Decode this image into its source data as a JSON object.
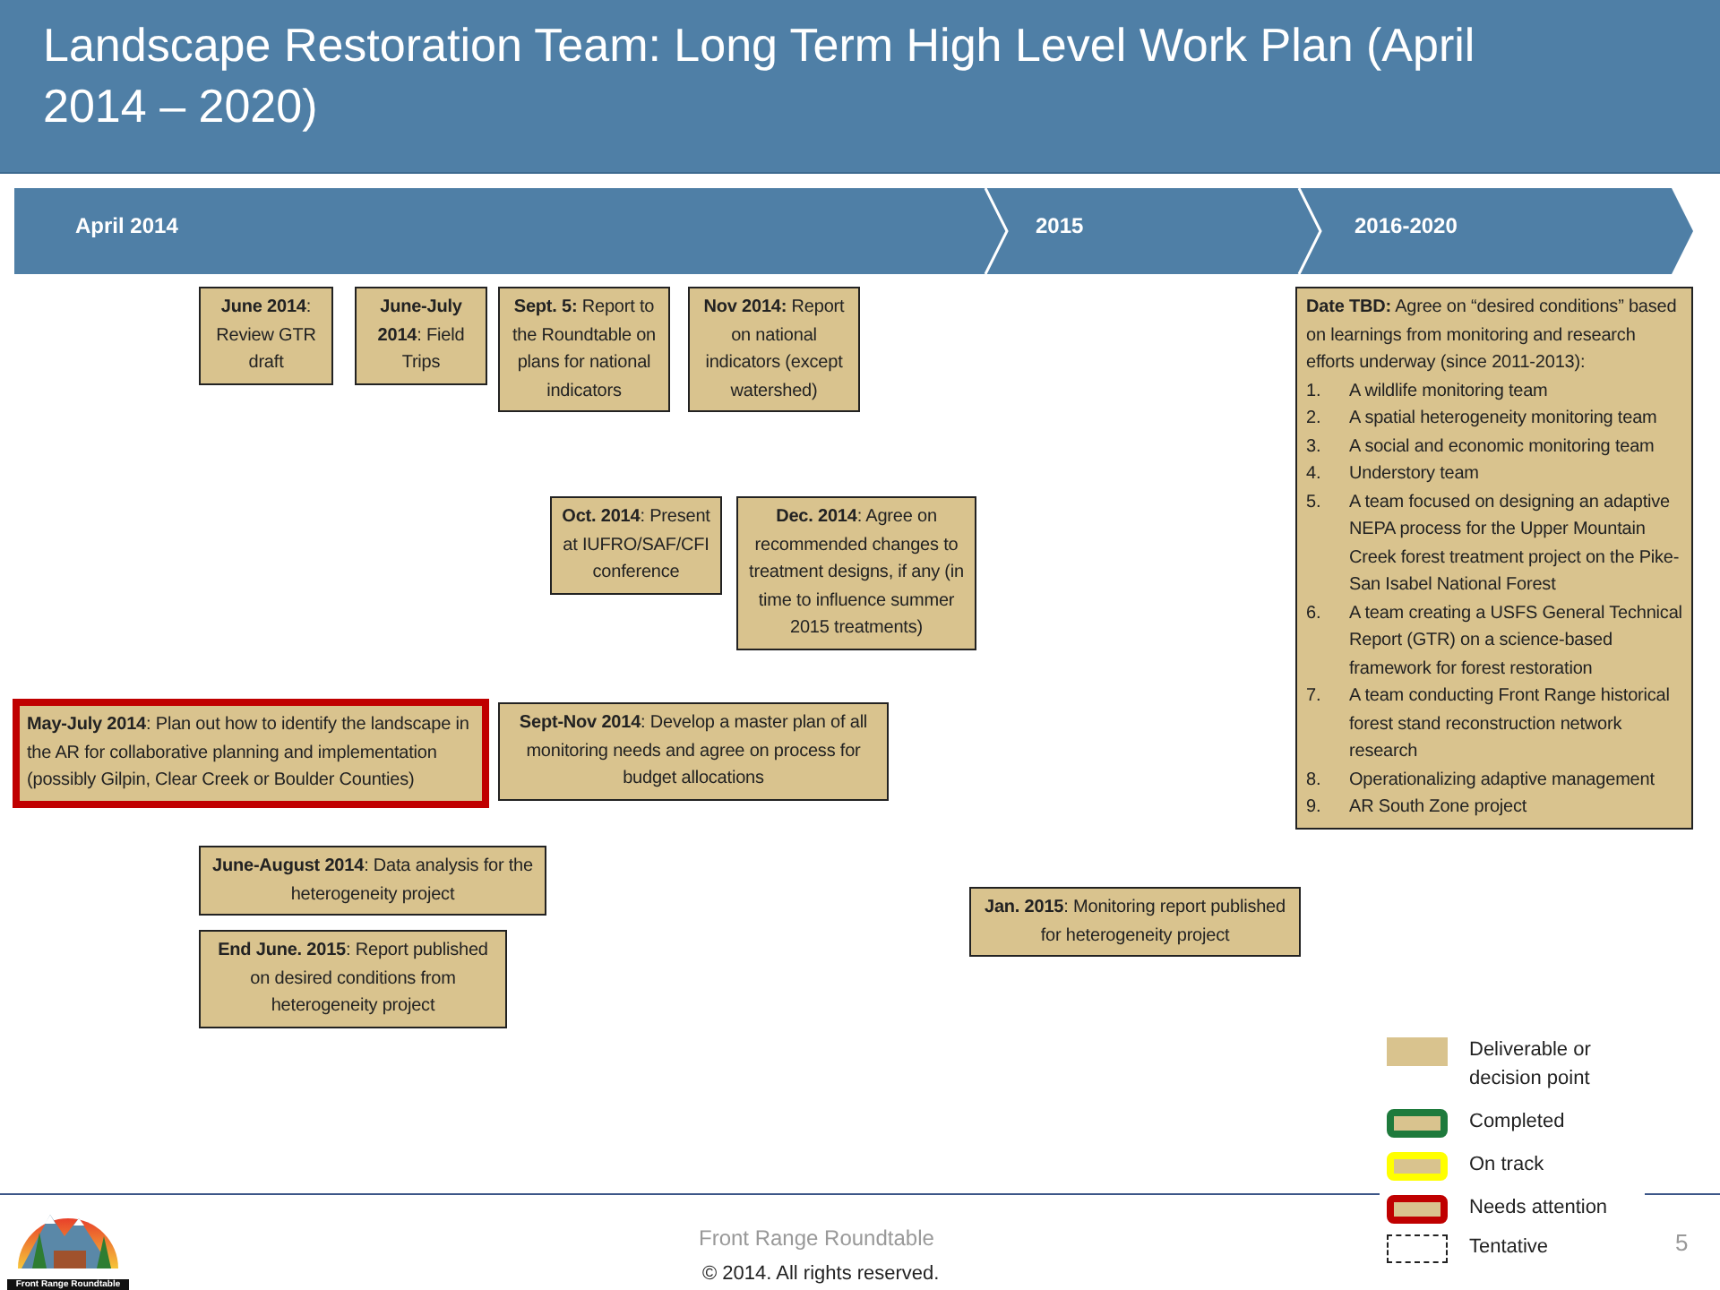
{
  "title": "Landscape Restoration Team: Long Term High Level Work Plan (April 2014 – 2020)",
  "timeline": [
    {
      "label": "April 2014"
    },
    {
      "label": "2015"
    },
    {
      "label": "2016-2020"
    }
  ],
  "milestones": [
    {
      "text": "**June 2014**: Review GTR draft",
      "kind": "deliverable"
    },
    {
      "text": "**June-July 2014**: Field Trips",
      "kind": "deliverable"
    },
    {
      "text": "**Sept. 5:** Report to the Roundtable on plans for national indicators",
      "kind": "deliverable"
    },
    {
      "text": "**Nov 2014:** Report on national indicators (except watershed)",
      "kind": "deliverable"
    },
    {
      "text": "**Oct. 2014**: Present at IUFRO/SAF/CFI conference",
      "kind": "deliverable"
    },
    {
      "text": "**Dec. 2014**: Agree on recommended changes to treatment designs, if any (in time to influence summer 2015 treatments)",
      "kind": "deliverable"
    },
    {
      "text": "**May-July 2014**: Plan out how to identify the landscape in the AR for collaborative planning and implementation (possibly Gilpin, Clear Creek or Boulder Counties)",
      "kind": "attention"
    },
    {
      "text": "**Sept-Nov 2014**: Develop a master plan of all monitoring needs and agree on process for budget allocations",
      "kind": "deliverable"
    },
    {
      "text": "**June-August 2014**: Data analysis for the heterogeneity project",
      "kind": "deliverable"
    },
    {
      "text": "**End June. 2015**: Report published on desired conditions from heterogeneity project",
      "kind": "deliverable"
    },
    {
      "text": "**Jan. 2015**: Monitoring report published for heterogeneity project",
      "kind": "deliverable"
    }
  ],
  "long_term_card": {
    "kind": "deliverable",
    "intro": "**Date TBD:** Agree on “desired conditions” based on learnings from monitoring and research efforts underway (since 2011-2013):",
    "items": [
      {
        "number": "1.",
        "text": "A wildlife monitoring team"
      },
      {
        "number": "2.",
        "text": "A spatial heterogeneity monitoring team"
      },
      {
        "number": "3.",
        "text": "A social and economic monitoring team"
      },
      {
        "number": "4.",
        "text": "Understory team"
      },
      {
        "number": "5.",
        "text": "A team focused on designing an adaptive NEPA process for the Upper Mountain Creek forest treatment project on the Pike-San Isabel National Forest"
      },
      {
        "number": "6.",
        "text": "A team creating a USFS General Technical Report (GTR) on a science-based framework for forest restoration"
      },
      {
        "number": "7.",
        "text": "A team conducting Front Range historical forest stand reconstruction network research"
      },
      {
        "number": "8.",
        "text": "Operationalizing adaptive management"
      },
      {
        "number": "9.",
        "text": "AR South Zone project"
      }
    ]
  },
  "legend": [
    {
      "kind": "deliverable",
      "label": "Deliverable or decision point"
    },
    {
      "kind": "completed",
      "label": "Completed"
    },
    {
      "kind": "ontrack",
      "label": "On track"
    },
    {
      "kind": "attention",
      "label": "Needs attention"
    },
    {
      "kind": "tentative",
      "label": "Tentative"
    }
  ],
  "footer": {
    "logo_text": "Front Range Roundtable",
    "org": "Front Range Roundtable",
    "copyright": "© 2014. All rights reserved.",
    "page": "5"
  }
}
